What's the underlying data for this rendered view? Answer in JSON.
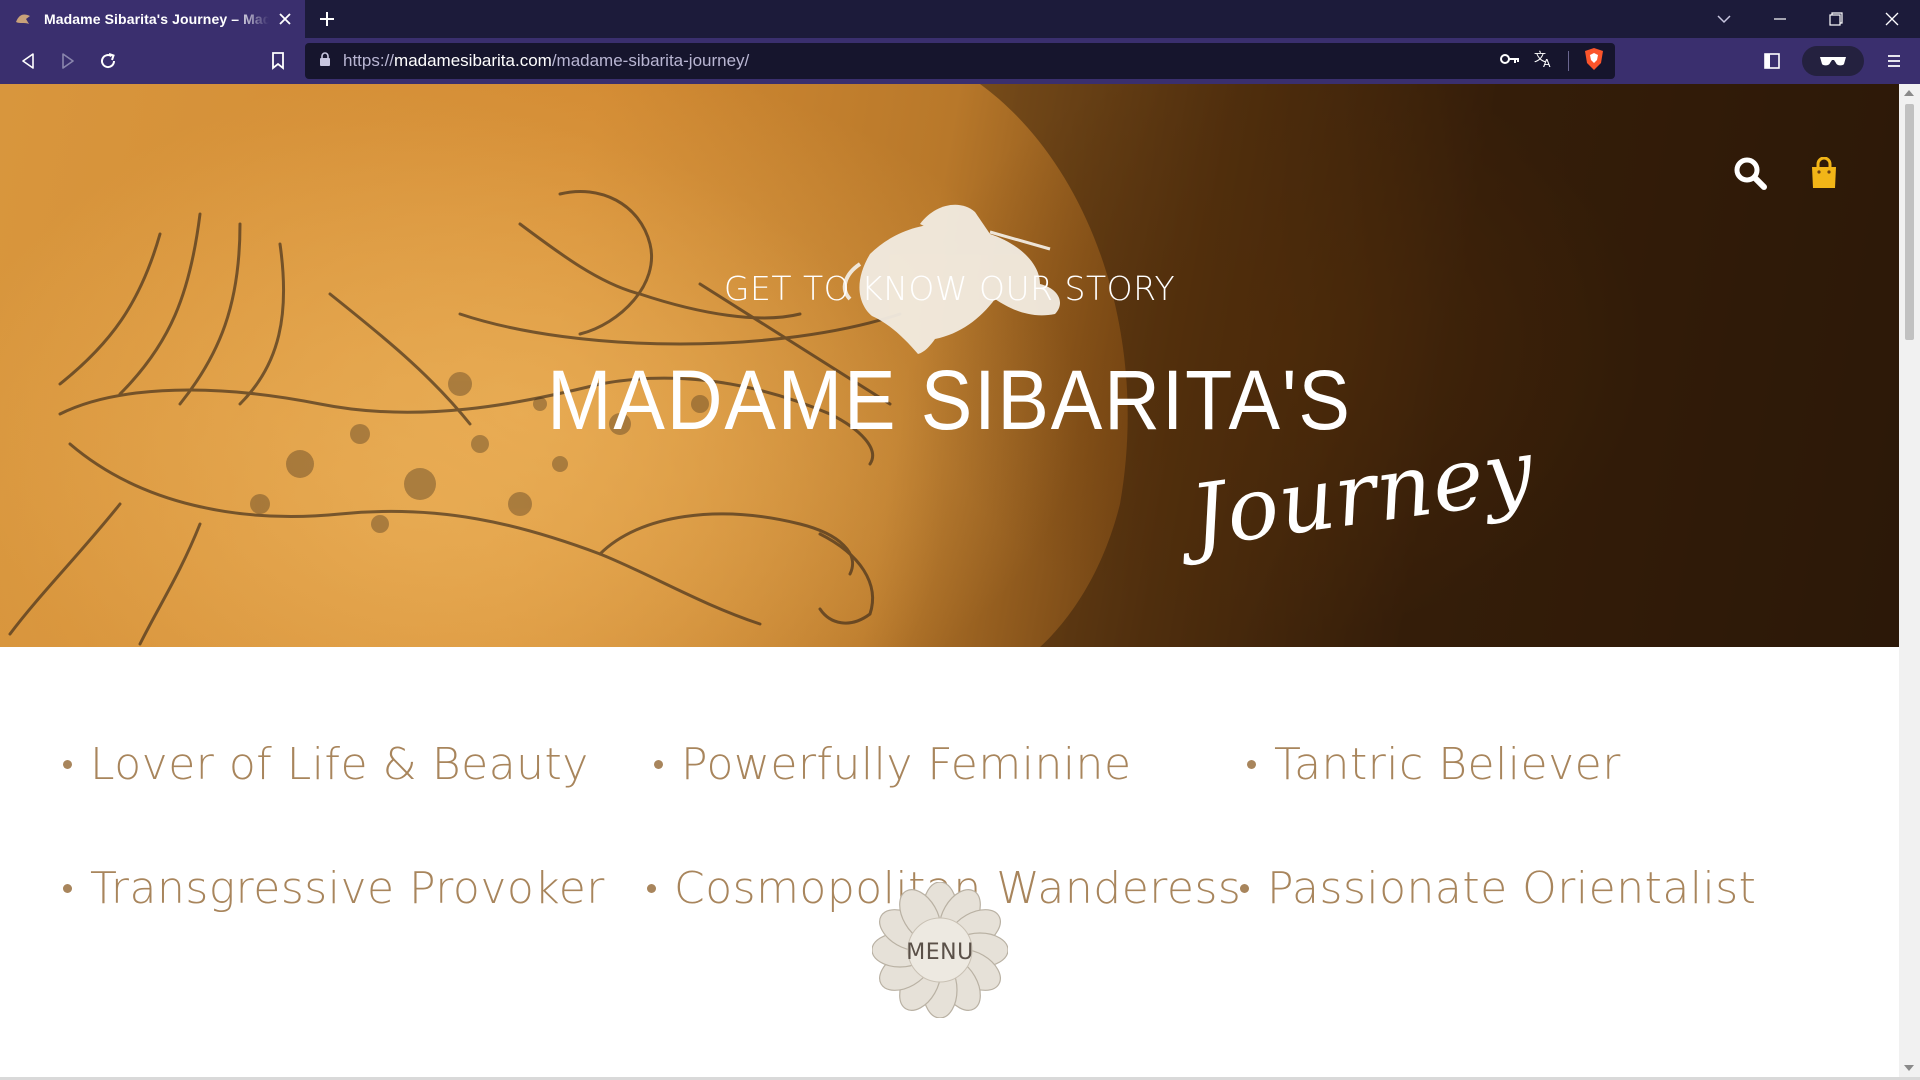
{
  "browser": {
    "tab": {
      "title": "Madame Sibarita's Journey – Madame Sibarita"
    },
    "new_tab_label": "+",
    "url": {
      "scheme": "https://",
      "host": "madamesibarita.com",
      "path": "/madame-sibarita-journey/"
    }
  },
  "hero": {
    "kicker": "GET TO KNOW OUR STORY",
    "title": "MADAME SIBARITA'S",
    "script": "Journey"
  },
  "traits": [
    "Lover of Life & Beauty",
    "Powerfully Feminine",
    "Tantric Believer",
    "Transgressive Provoker",
    "Cosmopolitan Wanderess",
    "Passionate Orientalist"
  ],
  "menu": {
    "label": "MENU"
  },
  "colors": {
    "browser_tabbar": "#1c1b3a",
    "browser_toolbar": "#3a2f6e",
    "trait_text": "#a8855c",
    "cart_icon": "#f2b517",
    "brave_shield": "#fb542b"
  }
}
